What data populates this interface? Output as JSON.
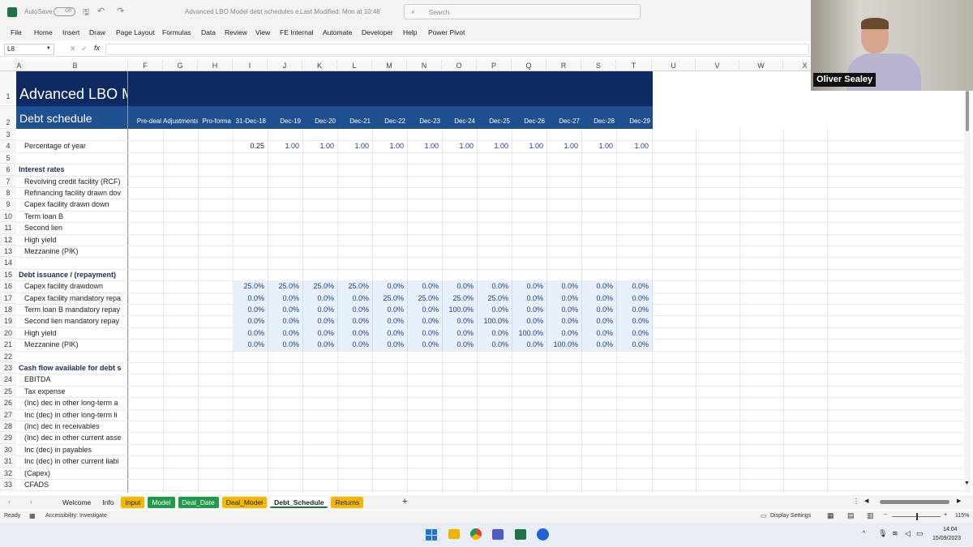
{
  "titlebar": {
    "autosave": "AutoSave",
    "autosave_state": "Off",
    "doc_title": "Advanced LBO Model debt schedules e...",
    "modified": "Last Modified: Mon at 10:48",
    "search_placeholder": "Search"
  },
  "ribbon": {
    "tabs": [
      "File",
      "Home",
      "Insert",
      "Draw",
      "Page Layout",
      "Formulas",
      "Data",
      "Review",
      "View",
      "FE Internal",
      "Automate",
      "Developer",
      "Help",
      "Power Pivot"
    ]
  },
  "formula_bar": {
    "name_box": "L8",
    "fx": "fx",
    "content": ""
  },
  "columns": [
    "A",
    "B",
    "F",
    "G",
    "H",
    "I",
    "J",
    "K",
    "L",
    "M",
    "N",
    "O",
    "P",
    "Q",
    "R",
    "S",
    "T",
    "U",
    "V",
    "W",
    "X"
  ],
  "sheet": {
    "title": "Advanced LBO M",
    "subtitle": "Debt schedule",
    "period_headers": [
      "Pre-deal",
      "Adjustments",
      "Pro-forma",
      "31-Dec-18",
      "Dec-19",
      "Dec-20",
      "Dec-21",
      "Dec-22",
      "Dec-23",
      "Dec-24",
      "Dec-25",
      "Dec-26",
      "Dec-27",
      "Dec-28",
      "Dec-29"
    ],
    "row_numbers": [
      "1",
      "2",
      "3",
      "4",
      "5",
      "6",
      "7",
      "8",
      "9",
      "10",
      "11",
      "12",
      "13",
      "14",
      "15",
      "16",
      "17",
      "18",
      "19",
      "20",
      "21",
      "22",
      "23",
      "24",
      "25",
      "26",
      "27",
      "28",
      "29",
      "30",
      "31",
      "32",
      "33"
    ],
    "labels": {
      "r4": "Percentage of year",
      "r6": "Interest rates",
      "r7": "Revolving credit facility (RCF)",
      "r8": "Refinancing facility drawn dov",
      "r9": "Capex facility drawn down",
      "r10": "Term loan B",
      "r11": "Second lien",
      "r12": "High yield",
      "r13": "Mezzanine (PIK)",
      "r15": "Debt issuance / (repayment)",
      "r16": "Capex facility drawdown",
      "r17": "Capex facility mandatory repa",
      "r18": "Term loan B mandatory repay",
      "r19": "Second lien mandatory repay",
      "r20": "High yield",
      "r21": "Mezzanine (PIK)",
      "r23": "Cash flow available for debt s",
      "r24": "EBITDA",
      "r25": "Tax expense",
      "r26": "(Inc) dec in other long-term a",
      "r27": "Inc (dec) in other long-term li",
      "r28": "(Inc) dec in receivables",
      "r29": "(Inc) dec in other current asse",
      "r30": "Inc (dec) in payables",
      "r31": "Inc (dec) in other current liabi",
      "r32": "(Capex)",
      "r33": "CFADS"
    },
    "pct_of_year": [
      "0.25",
      "1.00",
      "1.00",
      "1.00",
      "1.00",
      "1.00",
      "1.00",
      "1.00",
      "1.00",
      "1.00",
      "1.00",
      "1.00"
    ],
    "issuance_rows": [
      [
        "25.0%",
        "25.0%",
        "25.0%",
        "25.0%",
        "0.0%",
        "0.0%",
        "0.0%",
        "0.0%",
        "0.0%",
        "0.0%",
        "0.0%",
        "0.0%"
      ],
      [
        "0.0%",
        "0.0%",
        "0.0%",
        "0.0%",
        "25.0%",
        "25.0%",
        "25.0%",
        "25.0%",
        "0.0%",
        "0.0%",
        "0.0%",
        "0.0%"
      ],
      [
        "0.0%",
        "0.0%",
        "0.0%",
        "0.0%",
        "0.0%",
        "0.0%",
        "100.0%",
        "0.0%",
        "0.0%",
        "0.0%",
        "0.0%",
        "0.0%"
      ],
      [
        "0.0%",
        "0.0%",
        "0.0%",
        "0.0%",
        "0.0%",
        "0.0%",
        "0.0%",
        "100.0%",
        "0.0%",
        "0.0%",
        "0.0%",
        "0.0%"
      ],
      [
        "0.0%",
        "0.0%",
        "0.0%",
        "0.0%",
        "0.0%",
        "0.0%",
        "0.0%",
        "0.0%",
        "100.0%",
        "0.0%",
        "0.0%",
        "0.0%"
      ],
      [
        "0.0%",
        "0.0%",
        "0.0%",
        "0.0%",
        "0.0%",
        "0.0%",
        "0.0%",
        "0.0%",
        "0.0%",
        "100.0%",
        "0.0%",
        "0.0%"
      ]
    ]
  },
  "sheet_tabs": [
    {
      "label": "Welcome",
      "color": ""
    },
    {
      "label": "Info",
      "color": ""
    },
    {
      "label": "Input",
      "color": "#f5b800"
    },
    {
      "label": "Model",
      "color": "#1e9a4a"
    },
    {
      "label": "Deal_Date",
      "color": "#1e9a4a"
    },
    {
      "label": "Deal_Model",
      "color": "#f5b800"
    },
    {
      "label": "Debt_Schedule",
      "color": "active"
    },
    {
      "label": "Returns",
      "color": "#f5b800"
    }
  ],
  "status": {
    "ready": "Ready",
    "accessibility": "Accessibility: Investigate",
    "display": "Display Settings",
    "zoom": "115%"
  },
  "taskbar": {
    "time": "14:04",
    "date": "15/09/2023"
  },
  "video": {
    "name": "Oliver Sealey"
  },
  "colors": {
    "navy": "#0f2a63",
    "blue_band": "#1d4f91",
    "input_blue": "#1f3c88",
    "accent_green": "#217346"
  }
}
